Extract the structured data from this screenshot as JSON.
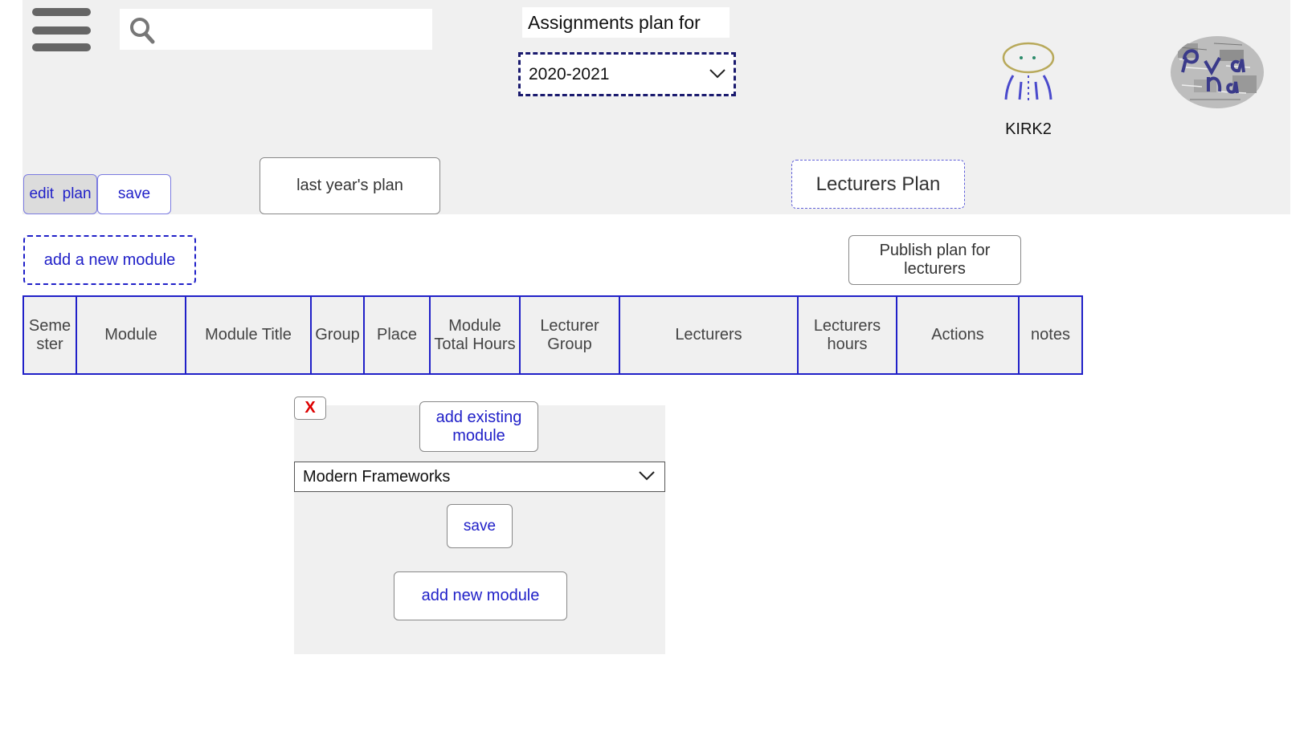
{
  "header": {
    "search": {
      "value": "",
      "placeholder": ""
    },
    "plan_title": "Assignments plan for",
    "year_select": {
      "selected": "2020-2021"
    },
    "user": {
      "name": "KIRK2"
    }
  },
  "toolbar": {
    "edit_plan_label": "edit  plan",
    "save_label": "save",
    "last_year_label": "last year's plan",
    "lecturers_plan_label": "Lecturers Plan",
    "add_module_label": "add a new module",
    "publish_label": "Publish plan for lecturers"
  },
  "table": {
    "columns": [
      "Seme ster",
      "Module",
      "Module Title",
      "Group",
      "Place",
      "Module Total Hours",
      "Lecturer Group",
      "Lecturers",
      "Lecturers hours",
      "Actions",
      "notes"
    ]
  },
  "popup": {
    "close_label": "X",
    "add_existing_label": "add existing module",
    "module_select": {
      "selected": "Modern Frameworks"
    },
    "save_label": "save",
    "add_new_label": "add new module"
  },
  "colors": {
    "accent": "#2020c8",
    "header_bg": "#f0f0f0",
    "close_red": "#d00000"
  },
  "icons": [
    "hamburger-menu-icon",
    "search-icon",
    "chevron-down-icon",
    "user-avatar-icon",
    "brand-logo"
  ]
}
